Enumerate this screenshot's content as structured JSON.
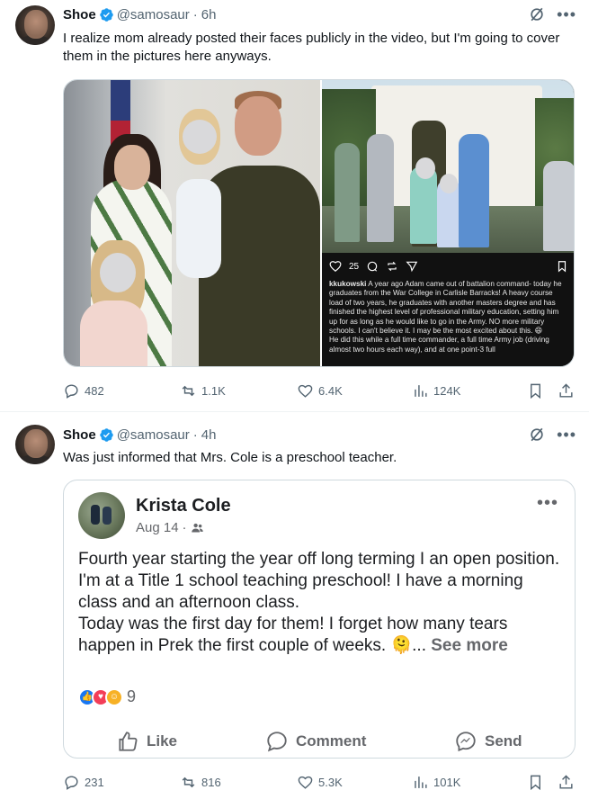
{
  "tweets": [
    {
      "author": "Shoe",
      "handle": "@samosaur",
      "separator": "·",
      "time": "6h",
      "text": "I realize mom already posted their faces publicly in the video, but I'm going to cover them in the pictures here anyways.",
      "instagram": {
        "likes": "25",
        "username": "kkukowski",
        "caption": "A year ago Adam came out of battalion command- today he graduates from the War College in Carlisle Barracks! A heavy course load of two years, he graduates with another masters degree and has finished the highest level of professional military education, setting him up for as long as he would like to go in the Army. NO more military schools. I can't believe it. I may be the most excited about this. 😄",
        "caption2": "He did this while a full time commander, a full time Army job (driving almost two hours each way), and at one point-3 full"
      },
      "metrics": {
        "replies": "482",
        "reposts": "1.1K",
        "likes": "6.4K",
        "views": "124K"
      }
    },
    {
      "author": "Shoe",
      "handle": "@samosaur",
      "separator": "·",
      "time": "4h",
      "text": "Was just informed that Mrs. Cole is a preschool teacher.",
      "facebook": {
        "name": "Krista Cole",
        "date": "Aug 14",
        "dot": "·",
        "body": "Fourth year starting the year off long terming I an open position.\nI'm at a Title 1 school teaching preschool! I have a morning class and an afternoon class.\nToday was the first day for them! I forget how many tears happen in Prek the first couple of weeks. 🫠...",
        "see_more": "See more",
        "reaction_count": "9",
        "like": "Like",
        "comment": "Comment",
        "send": "Send"
      },
      "metrics": {
        "replies": "231",
        "reposts": "816",
        "likes": "5.3K",
        "views": "101K"
      }
    }
  ],
  "colors": {
    "verified": "#1d9bf0",
    "muted": "#536471",
    "text": "#0f1419",
    "border": "#cfd9de"
  }
}
